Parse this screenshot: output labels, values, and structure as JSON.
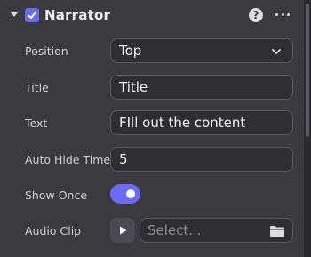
{
  "component": {
    "title": "Narrator",
    "enabled": true
  },
  "header_icons": {
    "collapse": "chevron-down-icon",
    "help": "?",
    "more": "more-icon"
  },
  "fields": {
    "position": {
      "label": "Position",
      "value": "Top"
    },
    "title": {
      "label": "Title",
      "value": "Title"
    },
    "text": {
      "label": "Text",
      "value": "FIll out the content"
    },
    "auto_hide_time": {
      "label": "Auto Hide Time",
      "value": "5"
    },
    "show_once": {
      "label": "Show Once",
      "value": true
    },
    "audio_clip": {
      "label": "Audio Clip",
      "placeholder": "Select..."
    }
  },
  "colors": {
    "accent": "#6a6cf5",
    "panel_bg": "#3a3a3f",
    "field_bg": "#2f2f33",
    "field_border": "#5b5b62"
  }
}
